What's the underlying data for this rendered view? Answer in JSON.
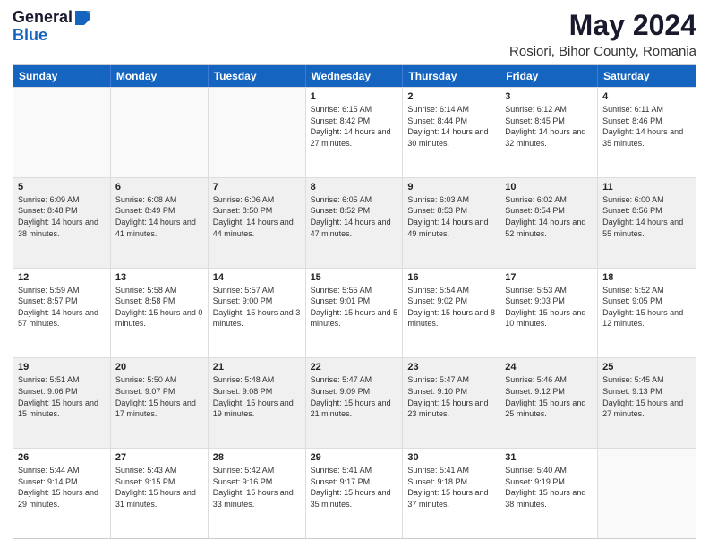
{
  "logo": {
    "general": "General",
    "blue": "Blue"
  },
  "title": "May 2024",
  "subtitle": "Rosiori, Bihor County, Romania",
  "header": {
    "days": [
      "Sunday",
      "Monday",
      "Tuesday",
      "Wednesday",
      "Thursday",
      "Friday",
      "Saturday"
    ]
  },
  "rows": [
    [
      {
        "day": "",
        "empty": true
      },
      {
        "day": "",
        "empty": true
      },
      {
        "day": "",
        "empty": true
      },
      {
        "day": "1",
        "rise": "6:15 AM",
        "set": "8:42 PM",
        "daylight": "14 hours and 27 minutes."
      },
      {
        "day": "2",
        "rise": "6:14 AM",
        "set": "8:44 PM",
        "daylight": "14 hours and 30 minutes."
      },
      {
        "day": "3",
        "rise": "6:12 AM",
        "set": "8:45 PM",
        "daylight": "14 hours and 32 minutes."
      },
      {
        "day": "4",
        "rise": "6:11 AM",
        "set": "8:46 PM",
        "daylight": "14 hours and 35 minutes."
      }
    ],
    [
      {
        "day": "5",
        "rise": "6:09 AM",
        "set": "8:48 PM",
        "daylight": "14 hours and 38 minutes."
      },
      {
        "day": "6",
        "rise": "6:08 AM",
        "set": "8:49 PM",
        "daylight": "14 hours and 41 minutes."
      },
      {
        "day": "7",
        "rise": "6:06 AM",
        "set": "8:50 PM",
        "daylight": "14 hours and 44 minutes."
      },
      {
        "day": "8",
        "rise": "6:05 AM",
        "set": "8:52 PM",
        "daylight": "14 hours and 47 minutes."
      },
      {
        "day": "9",
        "rise": "6:03 AM",
        "set": "8:53 PM",
        "daylight": "14 hours and 49 minutes."
      },
      {
        "day": "10",
        "rise": "6:02 AM",
        "set": "8:54 PM",
        "daylight": "14 hours and 52 minutes."
      },
      {
        "day": "11",
        "rise": "6:00 AM",
        "set": "8:56 PM",
        "daylight": "14 hours and 55 minutes."
      }
    ],
    [
      {
        "day": "12",
        "rise": "5:59 AM",
        "set": "8:57 PM",
        "daylight": "14 hours and 57 minutes."
      },
      {
        "day": "13",
        "rise": "5:58 AM",
        "set": "8:58 PM",
        "daylight": "15 hours and 0 minutes."
      },
      {
        "day": "14",
        "rise": "5:57 AM",
        "set": "9:00 PM",
        "daylight": "15 hours and 3 minutes."
      },
      {
        "day": "15",
        "rise": "5:55 AM",
        "set": "9:01 PM",
        "daylight": "15 hours and 5 minutes."
      },
      {
        "day": "16",
        "rise": "5:54 AM",
        "set": "9:02 PM",
        "daylight": "15 hours and 8 minutes."
      },
      {
        "day": "17",
        "rise": "5:53 AM",
        "set": "9:03 PM",
        "daylight": "15 hours and 10 minutes."
      },
      {
        "day": "18",
        "rise": "5:52 AM",
        "set": "9:05 PM",
        "daylight": "15 hours and 12 minutes."
      }
    ],
    [
      {
        "day": "19",
        "rise": "5:51 AM",
        "set": "9:06 PM",
        "daylight": "15 hours and 15 minutes."
      },
      {
        "day": "20",
        "rise": "5:50 AM",
        "set": "9:07 PM",
        "daylight": "15 hours and 17 minutes."
      },
      {
        "day": "21",
        "rise": "5:48 AM",
        "set": "9:08 PM",
        "daylight": "15 hours and 19 minutes."
      },
      {
        "day": "22",
        "rise": "5:47 AM",
        "set": "9:09 PM",
        "daylight": "15 hours and 21 minutes."
      },
      {
        "day": "23",
        "rise": "5:47 AM",
        "set": "9:10 PM",
        "daylight": "15 hours and 23 minutes."
      },
      {
        "day": "24",
        "rise": "5:46 AM",
        "set": "9:12 PM",
        "daylight": "15 hours and 25 minutes."
      },
      {
        "day": "25",
        "rise": "5:45 AM",
        "set": "9:13 PM",
        "daylight": "15 hours and 27 minutes."
      }
    ],
    [
      {
        "day": "26",
        "rise": "5:44 AM",
        "set": "9:14 PM",
        "daylight": "15 hours and 29 minutes."
      },
      {
        "day": "27",
        "rise": "5:43 AM",
        "set": "9:15 PM",
        "daylight": "15 hours and 31 minutes."
      },
      {
        "day": "28",
        "rise": "5:42 AM",
        "set": "9:16 PM",
        "daylight": "15 hours and 33 minutes."
      },
      {
        "day": "29",
        "rise": "5:41 AM",
        "set": "9:17 PM",
        "daylight": "15 hours and 35 minutes."
      },
      {
        "day": "30",
        "rise": "5:41 AM",
        "set": "9:18 PM",
        "daylight": "15 hours and 37 minutes."
      },
      {
        "day": "31",
        "rise": "5:40 AM",
        "set": "9:19 PM",
        "daylight": "15 hours and 38 minutes."
      },
      {
        "day": "",
        "empty": true
      }
    ]
  ]
}
